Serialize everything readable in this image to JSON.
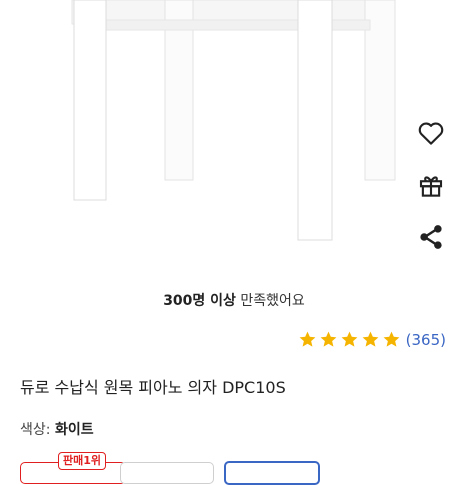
{
  "product": {
    "image_alt_name": "white wooden piano chair",
    "satisfaction_bold": "300명 이상",
    "satisfaction_rest": " 만족했어요",
    "rating": {
      "stars": 5,
      "max": 5,
      "count_text": "(365)"
    },
    "title": "듀로 수납식 원목 피아노 의자 DPC10S",
    "color_label": "색상: ",
    "color_value": "화이트"
  },
  "side_actions": [
    {
      "name": "wishlist",
      "icon": "heart-icon"
    },
    {
      "name": "gift",
      "icon": "gift-icon"
    },
    {
      "name": "share",
      "icon": "share-icon"
    }
  ],
  "options": {
    "badge": "판매1위"
  },
  "colors": {
    "star": "#f5b400",
    "link": "#3a66c4",
    "badge": "#e02020",
    "action_icon": "#222222"
  }
}
